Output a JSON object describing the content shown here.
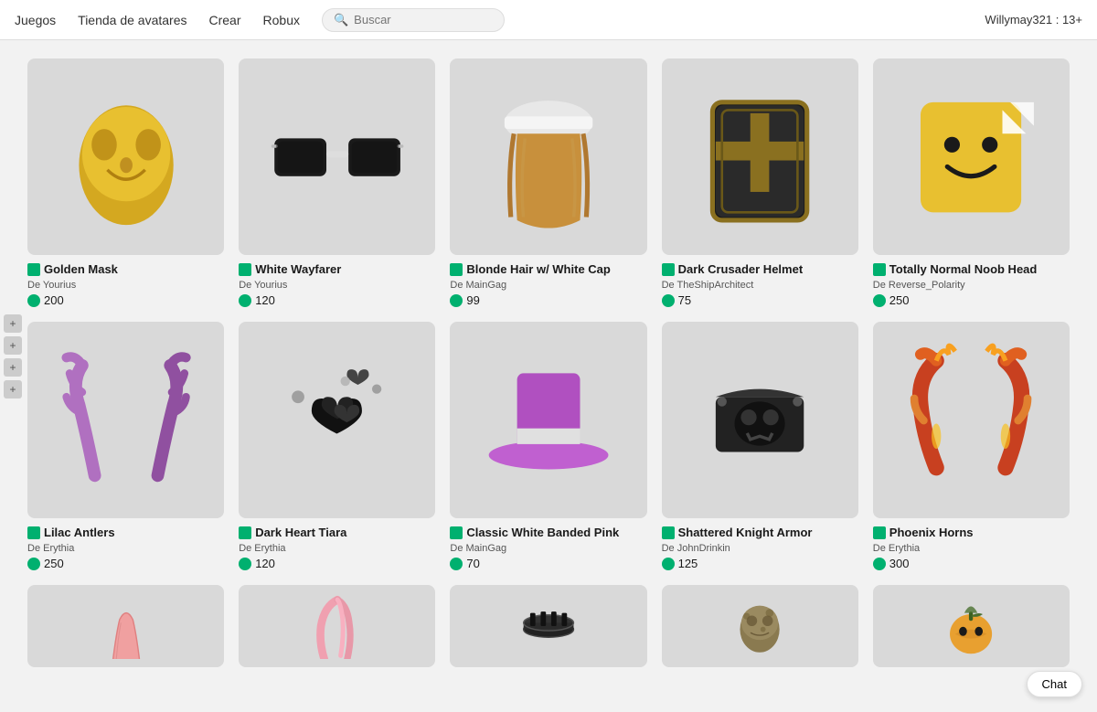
{
  "navbar": {
    "items": [
      {
        "label": "Juegos",
        "id": "juegos"
      },
      {
        "label": "Tienda de avatares",
        "id": "tienda"
      },
      {
        "label": "Crear",
        "id": "crear"
      },
      {
        "label": "Robux",
        "id": "robux"
      }
    ],
    "search_placeholder": "Buscar",
    "user": "Willymay321 : 13+"
  },
  "items": [
    {
      "id": "golden-mask",
      "name": "Golden Mask",
      "creator": "De Yourius",
      "price": 200,
      "color": "#d4a940",
      "shape": "mask"
    },
    {
      "id": "white-wayfarer",
      "name": "White Wayfarer",
      "creator": "De Yourius",
      "price": 120,
      "color": "#e0e0e0",
      "shape": "glasses"
    },
    {
      "id": "blonde-hair",
      "name": "Blonde Hair w/ White Cap",
      "creator": "De MainGag",
      "price": 99,
      "color": "#c89a5c",
      "shape": "hair"
    },
    {
      "id": "dark-crusader",
      "name": "Dark Crusader Helmet",
      "creator": "De TheShipArchitect",
      "price": 75,
      "color": "#2a2a2a",
      "shape": "helmet"
    },
    {
      "id": "totally-normal",
      "name": "Totally Normal Noob Head",
      "creator": "De Reverse_Polarity",
      "price": 250,
      "color": "#e8c840",
      "shape": "head"
    },
    {
      "id": "lilac-antlers",
      "name": "Lilac Antlers",
      "creator": "De Erythia",
      "price": 250,
      "color": "#b07ab0",
      "shape": "antlers"
    },
    {
      "id": "dark-heart",
      "name": "Dark Heart Tiara",
      "creator": "De Erythia",
      "price": 120,
      "color": "#222",
      "shape": "tiara"
    },
    {
      "id": "classic-white-banded",
      "name": "Classic White Banded Pink",
      "creator": "De MainGag",
      "price": 70,
      "color": "#b050b8",
      "shape": "tophat"
    },
    {
      "id": "shattered-knight",
      "name": "Shattered Knight Armor",
      "creator": "De JohnDrinkin",
      "price": 125,
      "color": "#333",
      "shape": "armor"
    },
    {
      "id": "phoenix-horns",
      "name": "Phoenix Horns",
      "creator": "De Erythia",
      "price": 300,
      "color": "#c84020",
      "shape": "horns"
    },
    {
      "id": "pink-item1",
      "name": "",
      "creator": "",
      "price": null,
      "color": "#f0a0a0",
      "shape": "cloth"
    },
    {
      "id": "pink-hair",
      "name": "",
      "creator": "",
      "price": null,
      "color": "#f0a0b0",
      "shape": "hair2"
    },
    {
      "id": "black-item",
      "name": "",
      "creator": "",
      "price": null,
      "color": "#222",
      "shape": "ring"
    },
    {
      "id": "military-head",
      "name": "",
      "creator": "",
      "price": null,
      "color": "#8a7a50",
      "shape": "skull"
    },
    {
      "id": "pumpkin-head",
      "name": "",
      "creator": "",
      "price": null,
      "color": "#e8a030",
      "shape": "pumpkin"
    }
  ],
  "chat_label": "Chat"
}
